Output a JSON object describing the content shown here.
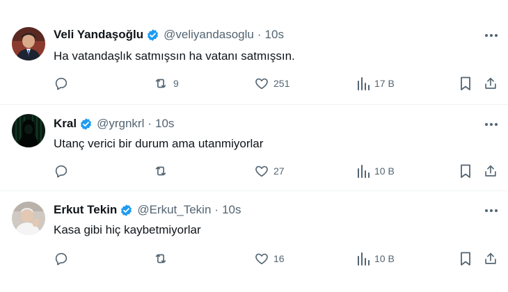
{
  "colors": {
    "verified": "#1d9bf0",
    "text": "#0f1419",
    "muted": "#536471",
    "divider": "#eff3f4"
  },
  "icons": {
    "reply": "reply-icon",
    "retweet": "retweet-icon",
    "like": "heart-icon",
    "views": "views-chart-icon",
    "bookmark": "bookmark-icon",
    "share": "share-icon",
    "verified": "verified-badge-icon",
    "more": "more-icon"
  },
  "tweets": [
    {
      "name": "Veli Yandaşoğlu",
      "handle": "@veliyandasoglu",
      "separator": "·",
      "time": "10s",
      "text": "Ha vatandaşlık satmışsın ha vatanı satmışsın.",
      "stats": {
        "retweets": "9",
        "likes": "251",
        "views": "17 B"
      }
    },
    {
      "name": "Kral",
      "handle": "@yrgnkrl",
      "separator": "·",
      "time": "10s",
      "text": "Utanç verici bir durum ama utanmiyorlar",
      "stats": {
        "retweets": "",
        "likes": "27",
        "views": "10 B"
      }
    },
    {
      "name": "Erkut Tekin",
      "handle": "@Erkut_Tekin",
      "separator": "·",
      "time": "10s",
      "text": "Kasa gibi hiç kaybetmiyorlar",
      "stats": {
        "retweets": "",
        "likes": "16",
        "views": "10 B"
      }
    }
  ]
}
